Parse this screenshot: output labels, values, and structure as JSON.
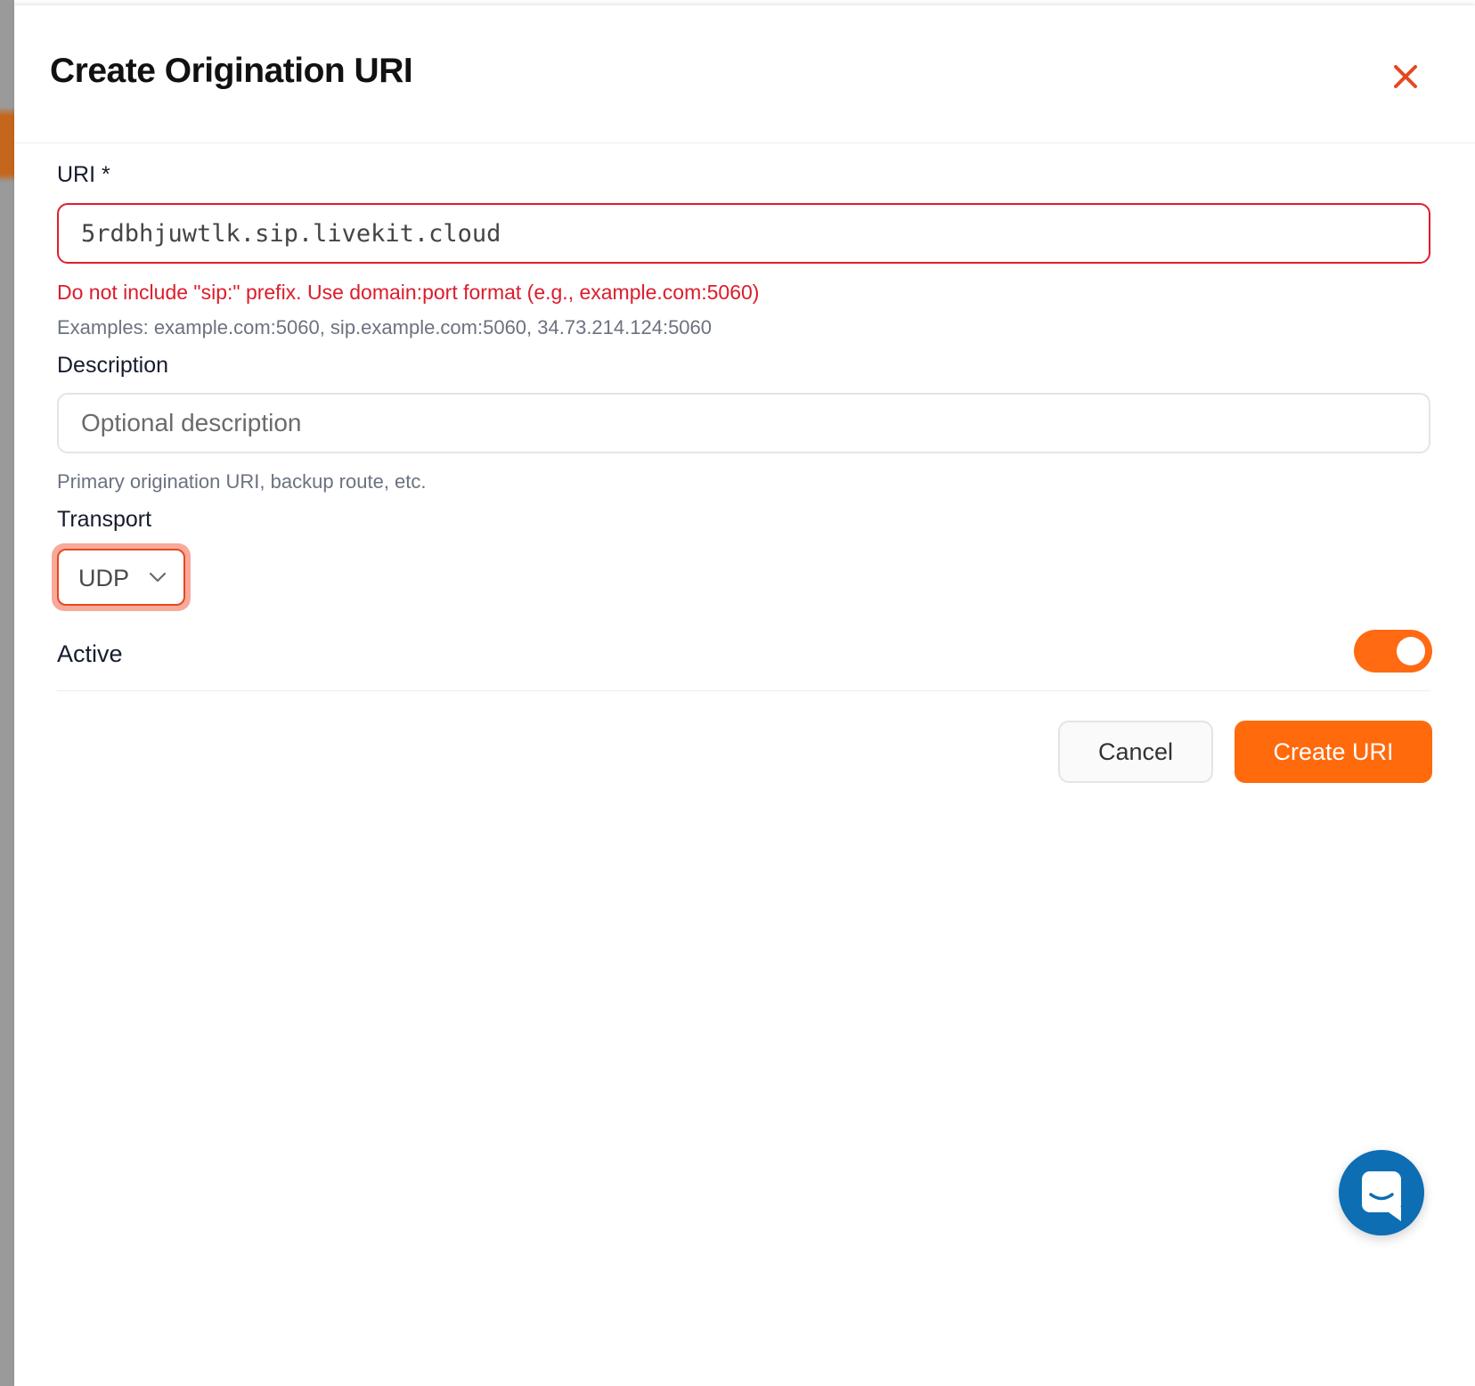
{
  "modal": {
    "title": "Create Origination URI"
  },
  "uri_field": {
    "label": "URI *",
    "value": "5rdbhjuwtlk.sip.livekit.cloud",
    "error": "Do not include \"sip:\" prefix. Use domain:port format (e.g., example.com:5060)",
    "helper": "Examples: example.com:5060, sip.example.com:5060, 34.73.214.124:5060"
  },
  "description_field": {
    "label": "Description",
    "placeholder": "Optional description",
    "helper": "Primary origination URI, backup route, etc."
  },
  "transport_field": {
    "label": "Transport",
    "selected": "UDP"
  },
  "active_field": {
    "label": "Active",
    "enabled": true
  },
  "actions": {
    "cancel_label": "Cancel",
    "create_label": "Create URI"
  },
  "colors": {
    "accent": "#ff6a0d",
    "error": "#dc1c2b",
    "chat_launcher": "#0d6eb3"
  },
  "icons": {
    "close": "close-icon",
    "chevron": "chevron-down-icon",
    "chat": "chat-icon"
  }
}
